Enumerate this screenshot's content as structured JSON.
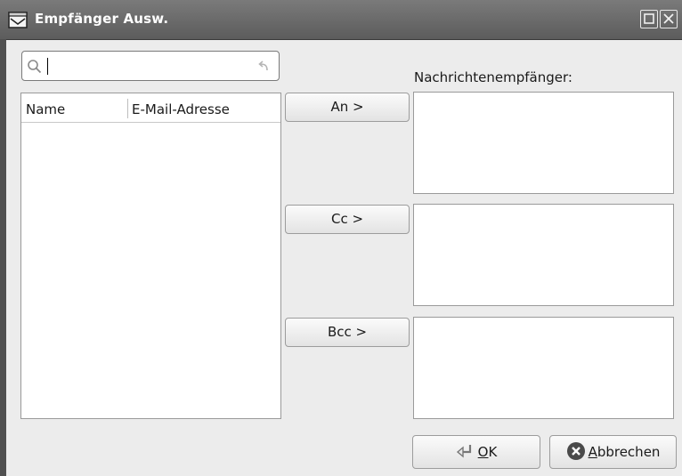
{
  "window": {
    "title": "Empfänger Ausw.",
    "icons": [
      "envelope-icon",
      "maximize-icon",
      "close-icon"
    ]
  },
  "search": {
    "value": "",
    "placeholder": ""
  },
  "contacts_table": {
    "columns": [
      "Name",
      "E-Mail-Adresse"
    ],
    "rows": []
  },
  "actions": {
    "to_label": "An >",
    "cc_label": "Cc >",
    "bcc_label": "Bcc >"
  },
  "recipients": {
    "label": "Nachrichtenempfänger:",
    "to": [],
    "cc": [],
    "bcc": []
  },
  "footer": {
    "ok_mnemonic": "O",
    "ok_rest": "K",
    "cancel_mnemonic": "A",
    "cancel_rest": "bbrechen"
  },
  "colors": {
    "titlebar": "#6a6a6a",
    "background": "#ececec",
    "cancel_icon": "#4a4a4a"
  }
}
